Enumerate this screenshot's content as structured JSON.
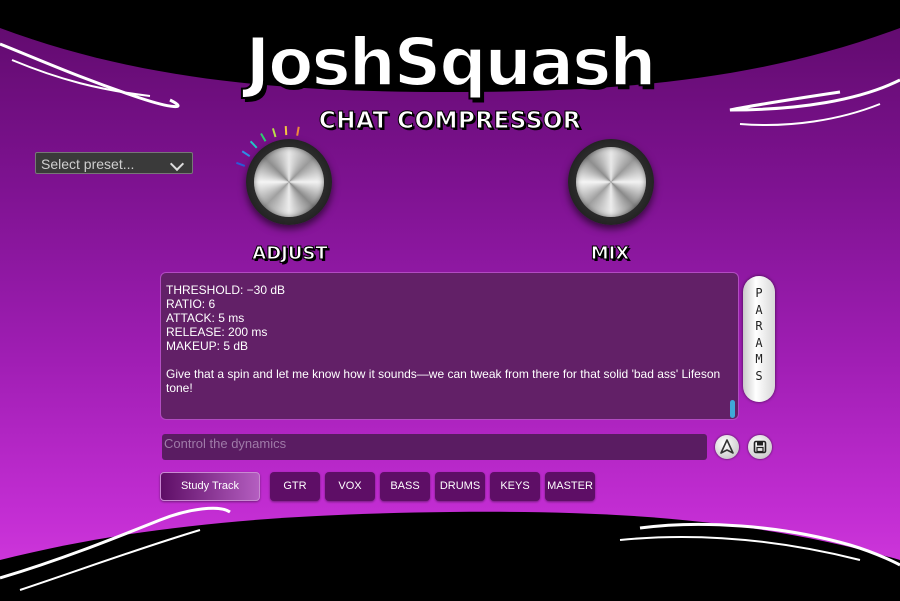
{
  "app": {
    "title": "JoshSquash",
    "subtitle": "CHAT COMPRESSOR"
  },
  "preset": {
    "label": "Select preset..."
  },
  "knobs": [
    {
      "label": "ADJUST"
    },
    {
      "label": "MIX"
    }
  ],
  "chat": {
    "lines": [
      "THRESHOLD: −30 dB",
      "RATIO: 6",
      "ATTACK: 5 ms",
      "RELEASE: 200 ms",
      "MAKEUP: 5 dB",
      "",
      "Give that a spin and let me know how it sounds—we can tweak from there for that solid 'bad ass' Lifeson tone!"
    ]
  },
  "params_button": {
    "letters": [
      "P",
      "A",
      "R",
      "A",
      "M",
      "S"
    ]
  },
  "input": {
    "placeholder": "Control the dynamics"
  },
  "actions": {
    "send_icon": "send-icon",
    "save_icon": "save-icon"
  },
  "tabs": [
    {
      "label": "Study Track"
    },
    {
      "label": "GTR"
    },
    {
      "label": "VOX"
    },
    {
      "label": "BASS"
    },
    {
      "label": "DRUMS"
    },
    {
      "label": "KEYS"
    },
    {
      "label": "MASTER"
    }
  ],
  "colors": {
    "accent": "#a01eb4",
    "knob_ring_colors": [
      "#2b5bd8",
      "#2e8ee6",
      "#22c5c5",
      "#2ecc71",
      "#b8e04a",
      "#f5c542",
      "#f08a3c"
    ]
  }
}
